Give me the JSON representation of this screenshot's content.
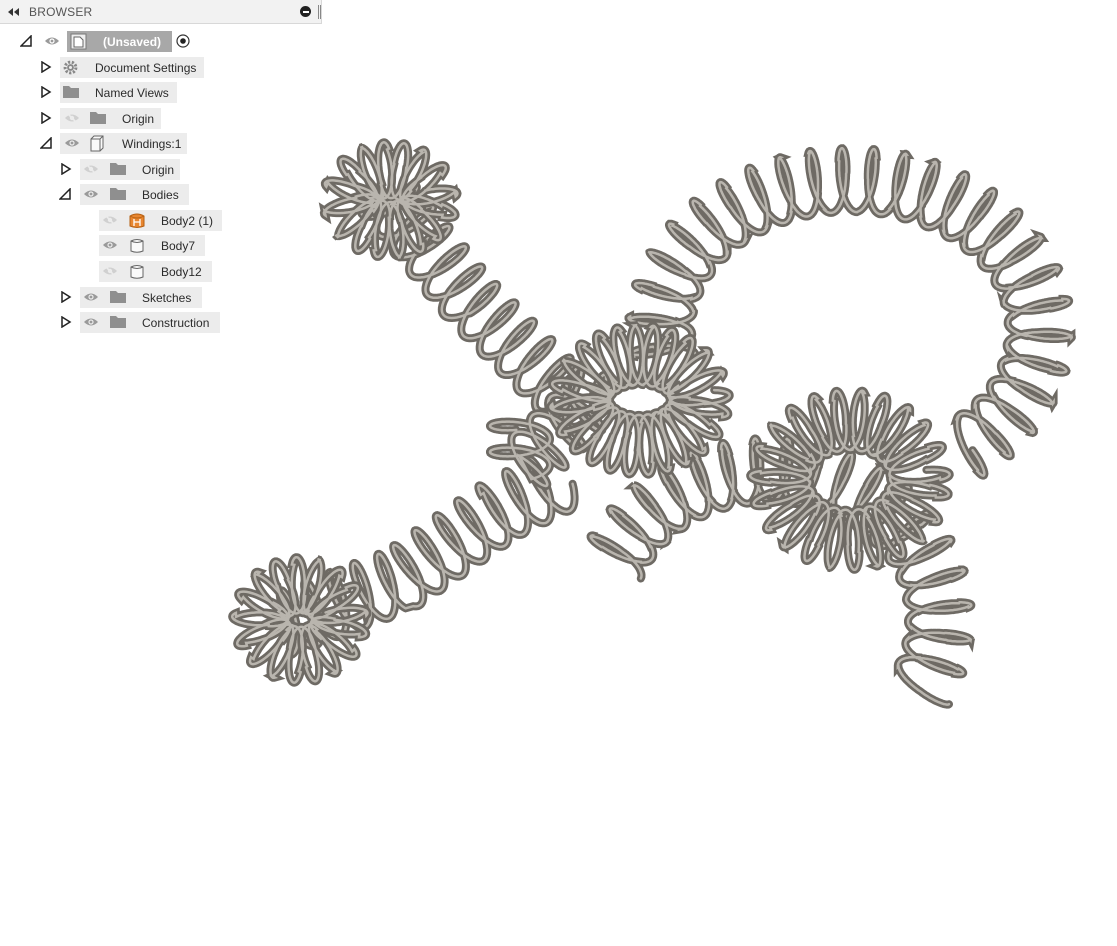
{
  "browser": {
    "title": "BROWSER",
    "root": {
      "label": "(Unsaved)"
    },
    "items": [
      {
        "label": "Document Settings"
      },
      {
        "label": "Named Views"
      },
      {
        "label": "Origin"
      },
      {
        "label": "Windings:1"
      },
      {
        "label": "Origin"
      },
      {
        "label": "Bodies"
      },
      {
        "label": "Body2 (1)"
      },
      {
        "label": "Body7"
      },
      {
        "label": "Body12"
      },
      {
        "label": "Sketches"
      },
      {
        "label": "Construction"
      }
    ]
  },
  "viewport": {
    "model": "coil-spring-windings"
  },
  "colors": {
    "coil": "#6e6a64",
    "coil_highlight": "#b9b5ae",
    "accent_orange": "#e8862f",
    "chip_bg": "#ececec"
  }
}
